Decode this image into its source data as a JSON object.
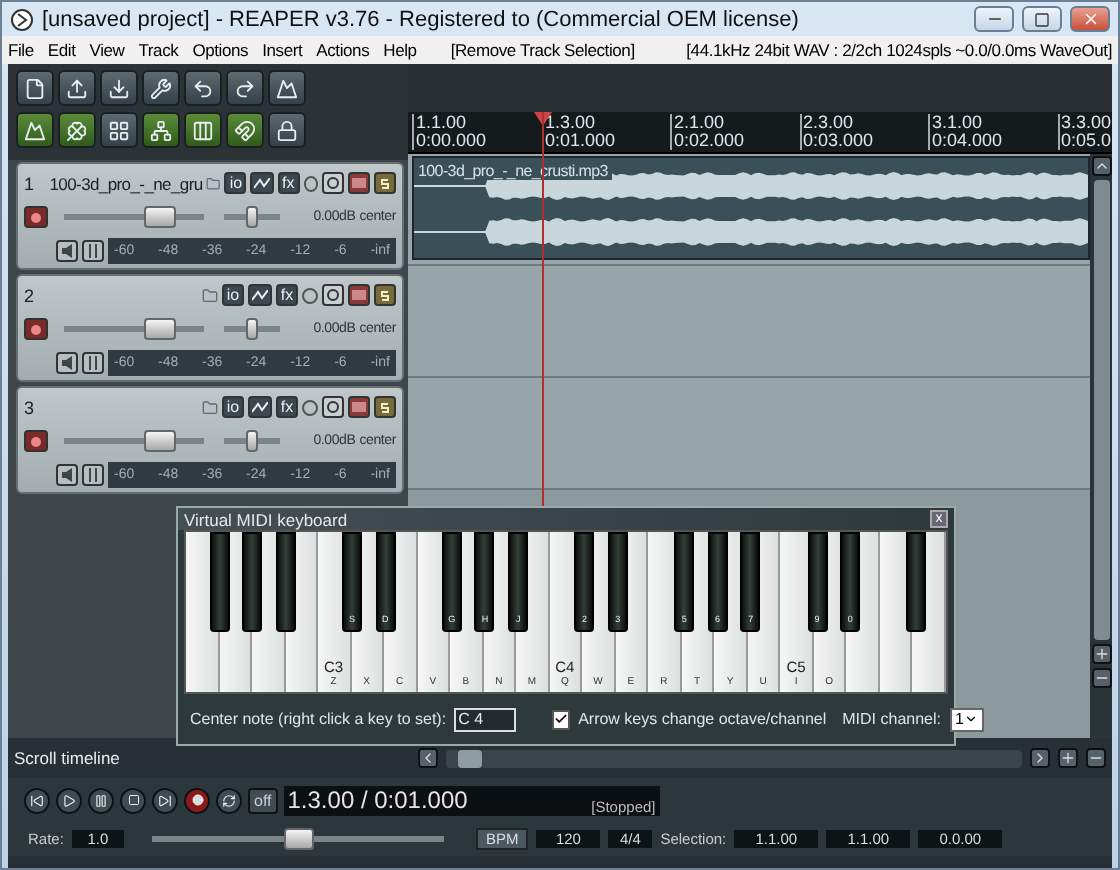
{
  "window": {
    "title": "[unsaved project] - REAPER v3.76 - Registered to  (Commercial OEM license)"
  },
  "menu": [
    "File",
    "Edit",
    "View",
    "Track",
    "Options",
    "Insert",
    "Actions",
    "Help"
  ],
  "menu_action": "[Remove Track Selection]",
  "audio_status": "[44.1kHz 24bit WAV : 2/2ch 1024spls ~0.0/0.0ms WaveOut]",
  "ruler": [
    {
      "bar": "1.1.00",
      "time": "0:00.000",
      "at_playhead": false
    },
    {
      "bar": "1.3.00",
      "time": "0:01.000",
      "at_playhead": true
    },
    {
      "bar": "2.1.00",
      "time": "0:02.000",
      "at_playhead": false
    },
    {
      "bar": "2.3.00",
      "time": "0:03.000",
      "at_playhead": false
    },
    {
      "bar": "3.1.00",
      "time": "0:04.000",
      "at_playhead": false
    },
    {
      "bar": "3.3.00",
      "time": "0:05.0",
      "at_playhead": false
    }
  ],
  "tracks": [
    {
      "number": "1",
      "name": "100-3d_pro_-_ne_gru",
      "io": "io",
      "fx": "fx",
      "volume": {
        "level": 0.68,
        "reading": "0.00dB"
      },
      "pan": {
        "level": 0.5,
        "reading": "center"
      },
      "meter_ticks": [
        "-60",
        "-48",
        "-36",
        "-24",
        "-12",
        "-6",
        "-inf"
      ],
      "item": {
        "name": "100-3d_pro_-_ne_crusti.mp3"
      }
    },
    {
      "number": "2",
      "io": "io",
      "fx": "fx",
      "volume": {
        "level": 0.68,
        "reading": "0.00dB"
      },
      "pan": {
        "level": 0.5,
        "reading": "center"
      },
      "meter_ticks": [
        "-60",
        "-48",
        "-36",
        "-24",
        "-12",
        "-6",
        "-inf"
      ]
    },
    {
      "number": "3",
      "io": "io",
      "fx": "fx",
      "volume": {
        "level": 0.68,
        "reading": "0.00dB"
      },
      "pan": {
        "level": 0.5,
        "reading": "center"
      },
      "meter_ticks": [
        "-60",
        "-48",
        "-36",
        "-24",
        "-12",
        "-6",
        "-inf"
      ]
    }
  ],
  "midi_keyboard": {
    "title": "Virtual MIDI keyboard",
    "close": "x",
    "keys": [
      {
        "kind": "white"
      },
      {
        "kind": "black"
      },
      {
        "kind": "white"
      },
      {
        "kind": "black"
      },
      {
        "kind": "white"
      },
      {
        "kind": "black"
      },
      {
        "kind": "white"
      },
      {
        "kind": "white",
        "note": "C3",
        "label": "Z"
      },
      {
        "kind": "black",
        "label": "S"
      },
      {
        "kind": "white",
        "label": "X"
      },
      {
        "kind": "black",
        "label": "D"
      },
      {
        "kind": "white",
        "label": "C"
      },
      {
        "kind": "white",
        "label": "V"
      },
      {
        "kind": "black",
        "label": "G"
      },
      {
        "kind": "white",
        "label": "B"
      },
      {
        "kind": "black",
        "label": "H"
      },
      {
        "kind": "white",
        "label": "N"
      },
      {
        "kind": "black",
        "label": "J"
      },
      {
        "kind": "white",
        "label": "M"
      },
      {
        "kind": "white",
        "note": "C4",
        "label": "Q"
      },
      {
        "kind": "black",
        "label": "2"
      },
      {
        "kind": "white",
        "label": "W"
      },
      {
        "kind": "black",
        "label": "3"
      },
      {
        "kind": "white",
        "label": "E"
      },
      {
        "kind": "white",
        "label": "R"
      },
      {
        "kind": "black",
        "label": "5"
      },
      {
        "kind": "white",
        "label": "T"
      },
      {
        "kind": "black",
        "label": "6"
      },
      {
        "kind": "white",
        "label": "Y"
      },
      {
        "kind": "black",
        "label": "7"
      },
      {
        "kind": "white",
        "label": "U"
      },
      {
        "kind": "white",
        "note": "C5",
        "label": "I"
      },
      {
        "kind": "black",
        "label": "9"
      },
      {
        "kind": "white",
        "label": "O"
      },
      {
        "kind": "black",
        "label": "0"
      },
      {
        "kind": "white"
      },
      {
        "kind": "white"
      },
      {
        "kind": "black"
      },
      {
        "kind": "white"
      }
    ],
    "center_note_label": "Center note (right click a key to set):",
    "center_note": "C 4",
    "arrow_keys": {
      "label": "Arrow keys change octave/channel",
      "checked": true
    },
    "midi_channel_label": "MIDI channel:",
    "midi_channel": "1"
  },
  "scroll_label": "Scroll timeline",
  "transport": {
    "repeat": "off",
    "position": "1.3.00 / 0:01.000",
    "state": "[Stopped]"
  },
  "bottom": {
    "rate_label": "Rate:",
    "rate": "1.0",
    "rate_slider": {
      "level": 0.5
    },
    "bpm_label": "BPM",
    "bpm": "120",
    "signature": "4/4",
    "selection_label": "Selection:",
    "selection": [
      "1.1.00",
      "1.1.00",
      "0.0.00"
    ]
  }
}
